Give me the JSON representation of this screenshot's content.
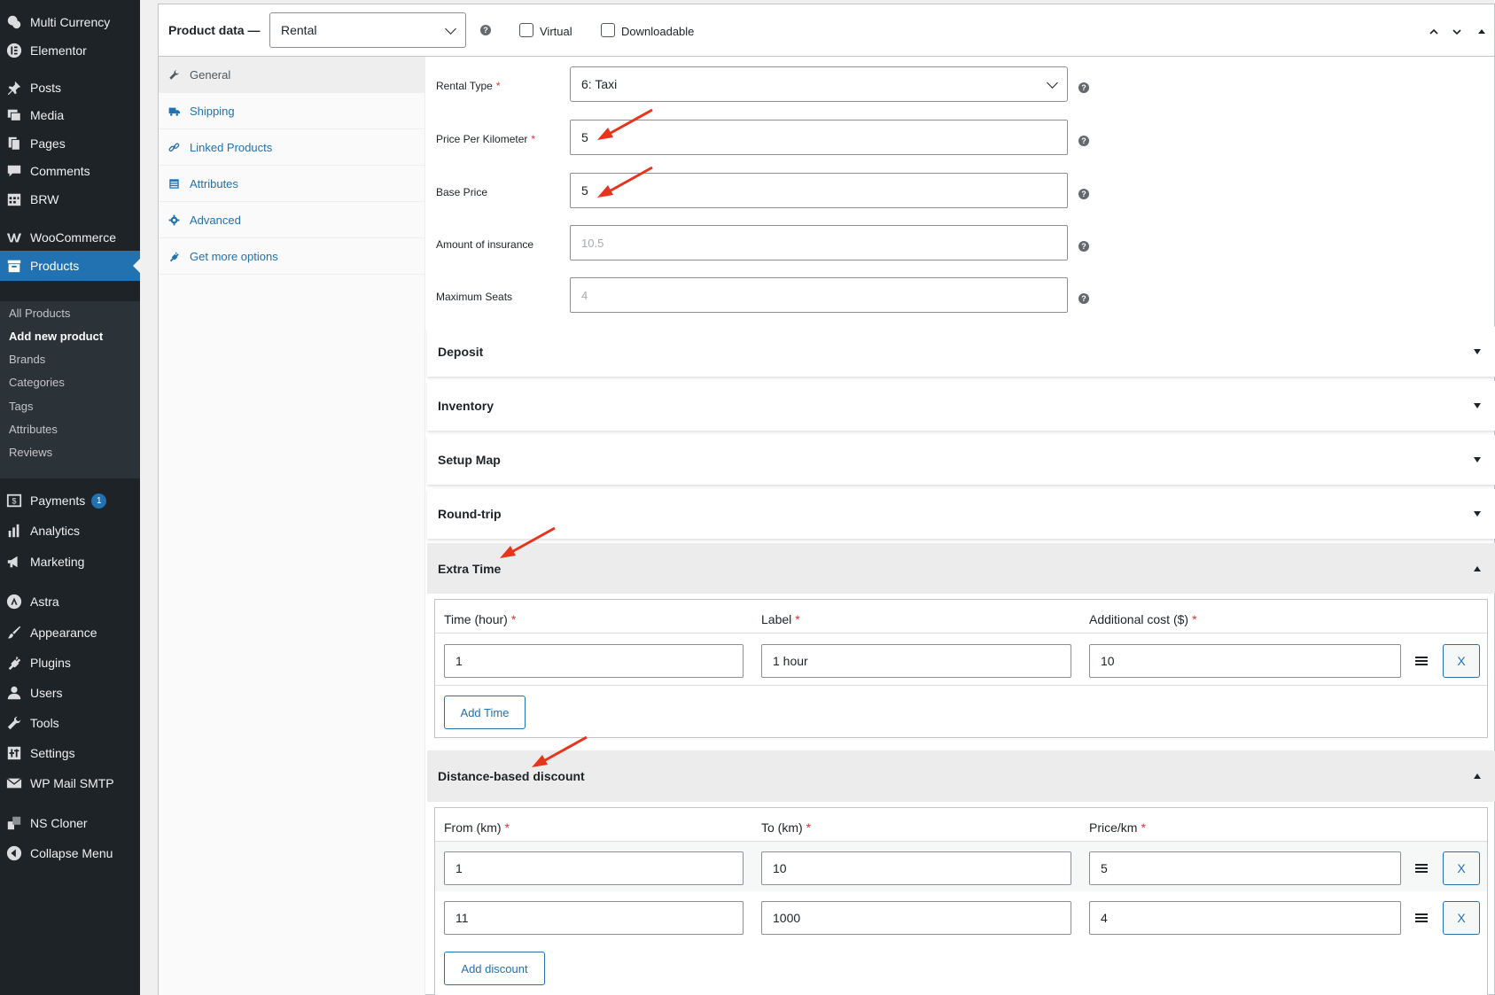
{
  "sidebar": {
    "items": [
      {
        "label": "Multi Currency",
        "icon": "multi-currency-icon"
      },
      {
        "label": "Elementor",
        "icon": "elementor-icon"
      },
      {
        "label": "Posts",
        "icon": "pin-icon"
      },
      {
        "label": "Media",
        "icon": "media-icon"
      },
      {
        "label": "Pages",
        "icon": "pages-icon"
      },
      {
        "label": "Comments",
        "icon": "comments-icon"
      },
      {
        "label": "BRW",
        "icon": "calendar-icon"
      },
      {
        "label": "WooCommerce",
        "icon": "woocommerce-icon"
      },
      {
        "label": "Products",
        "icon": "archive-icon"
      },
      {
        "label": "Payments",
        "icon": "payments-icon",
        "badge": "1"
      },
      {
        "label": "Analytics",
        "icon": "bar-chart-icon"
      },
      {
        "label": "Marketing",
        "icon": "megaphone-icon"
      },
      {
        "label": "Astra",
        "icon": "astra-icon"
      },
      {
        "label": "Appearance",
        "icon": "brush-icon"
      },
      {
        "label": "Plugins",
        "icon": "plug-icon"
      },
      {
        "label": "Users",
        "icon": "user-icon"
      },
      {
        "label": "Tools",
        "icon": "wrench-icon"
      },
      {
        "label": "Settings",
        "icon": "sliders-icon"
      },
      {
        "label": "WP Mail SMTP",
        "icon": "mail-icon"
      },
      {
        "label": "NS Cloner",
        "icon": "cloner-icon"
      },
      {
        "label": "Collapse Menu",
        "icon": "collapse-icon"
      }
    ],
    "submenu": [
      "All Products",
      "Add new product",
      "Brands",
      "Categories",
      "Tags",
      "Attributes",
      "Reviews"
    ]
  },
  "header": {
    "title": "Product data —",
    "product_type": "Rental",
    "virtual_label": "Virtual",
    "downloadable_label": "Downloadable"
  },
  "tabs": [
    {
      "label": "General",
      "icon": "wrench-icon"
    },
    {
      "label": "Shipping",
      "icon": "truck-icon"
    },
    {
      "label": "Linked Products",
      "icon": "link-icon"
    },
    {
      "label": "Attributes",
      "icon": "table-icon"
    },
    {
      "label": "Advanced",
      "icon": "gear-icon"
    },
    {
      "label": "Get more options",
      "icon": "plugin-icon"
    }
  ],
  "fields": {
    "rental_type": {
      "label": "Rental Type",
      "value": "6: Taxi"
    },
    "price_per_km": {
      "label": "Price Per Kilometer",
      "value": "5"
    },
    "base_price": {
      "label": "Base Price",
      "value": "5"
    },
    "insurance": {
      "label": "Amount of insurance",
      "placeholder": "10.5"
    },
    "max_seats": {
      "label": "Maximum Seats",
      "placeholder": "4"
    }
  },
  "sections": [
    "Deposit",
    "Inventory",
    "Setup Map",
    "Round-trip",
    "Extra Time",
    "Distance-based discount"
  ],
  "extra_time": {
    "headers": [
      "Time (hour)",
      "Label",
      "Additional cost ($)"
    ],
    "rows": [
      [
        "1",
        "1 hour",
        "10"
      ]
    ],
    "add_label": "Add Time",
    "remove_label": "X"
  },
  "discount": {
    "headers": [
      "From (km)",
      "To (km)",
      "Price/km"
    ],
    "rows": [
      [
        "1",
        "10",
        "5"
      ],
      [
        "11",
        "1000",
        "4"
      ]
    ],
    "add_label": "Add discount",
    "remove_label": "X"
  },
  "colors": {
    "accent": "#2271b1",
    "sidebar": "#1d2327",
    "required": "#d63638",
    "annotation": "#e8341c"
  }
}
